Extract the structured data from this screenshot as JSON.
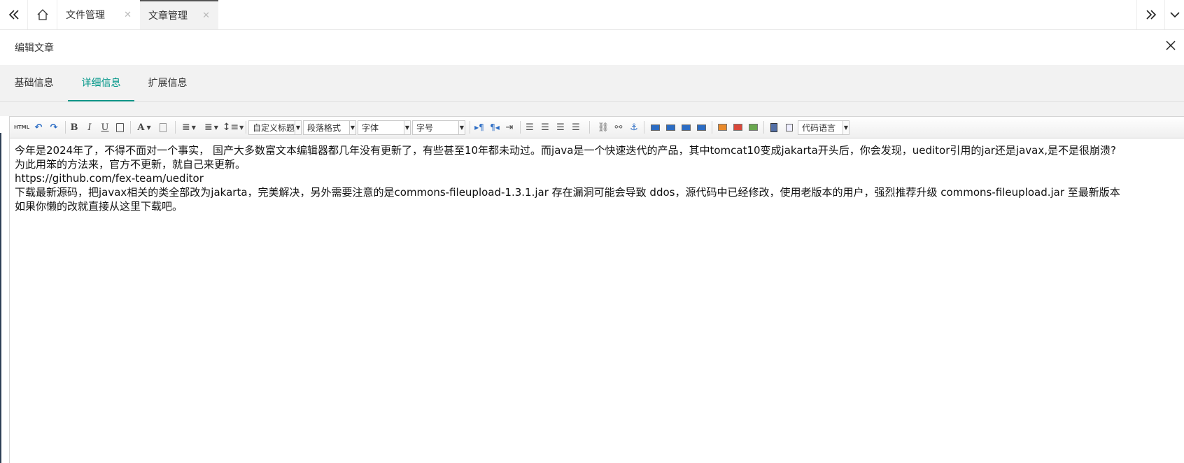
{
  "top_tabs": [
    {
      "label": "文件管理"
    },
    {
      "label": "文章管理"
    }
  ],
  "icons": {
    "nav_left": "double-chevron-left-icon",
    "home": "home-icon",
    "nav_right": "double-chevron-right-icon",
    "dropdown": "chevron-down-icon",
    "close": "close-icon"
  },
  "panel": {
    "title": "编辑文章"
  },
  "inner_tabs": [
    {
      "label": "基础信息"
    },
    {
      "label": "详细信息"
    },
    {
      "label": "扩展信息"
    }
  ],
  "toolbar": {
    "html": "HTML",
    "bold": "B",
    "italic": "I",
    "underline": "U",
    "font_color": "A",
    "custom_title": "自定义标题",
    "paragraph": "段落格式",
    "font_family": "字体",
    "font_size": "字号",
    "code_lang": "代码语言"
  },
  "content": {
    "lines": [
      "今年是2024年了，不得不面对一个事实， 国产大多数富文本编辑器都几年没有更新了，有些甚至10年都未动过。而java是一个快速迭代的产品，其中tomcat10变成jakarta开头后，你会发现，ueditor引用的jar还是javax,是不是很崩溃?",
      "为此用笨的方法来，官方不更新，就自己来更新。",
      "https://github.com/fex-team/ueditor",
      "下载最新源码，把javax相关的类全部改为jakarta，完美解决，另外需要注意的是commons-fileupload-1.3.1.jar 存在漏洞可能会导致 ddos，源代码中已经修改，使用老版本的用户，强烈推荐升级 commons-fileupload.jar 至最新版本",
      "如果你懒的改就直接从这里下载吧。"
    ]
  },
  "colors": {
    "accent": "#009688"
  }
}
